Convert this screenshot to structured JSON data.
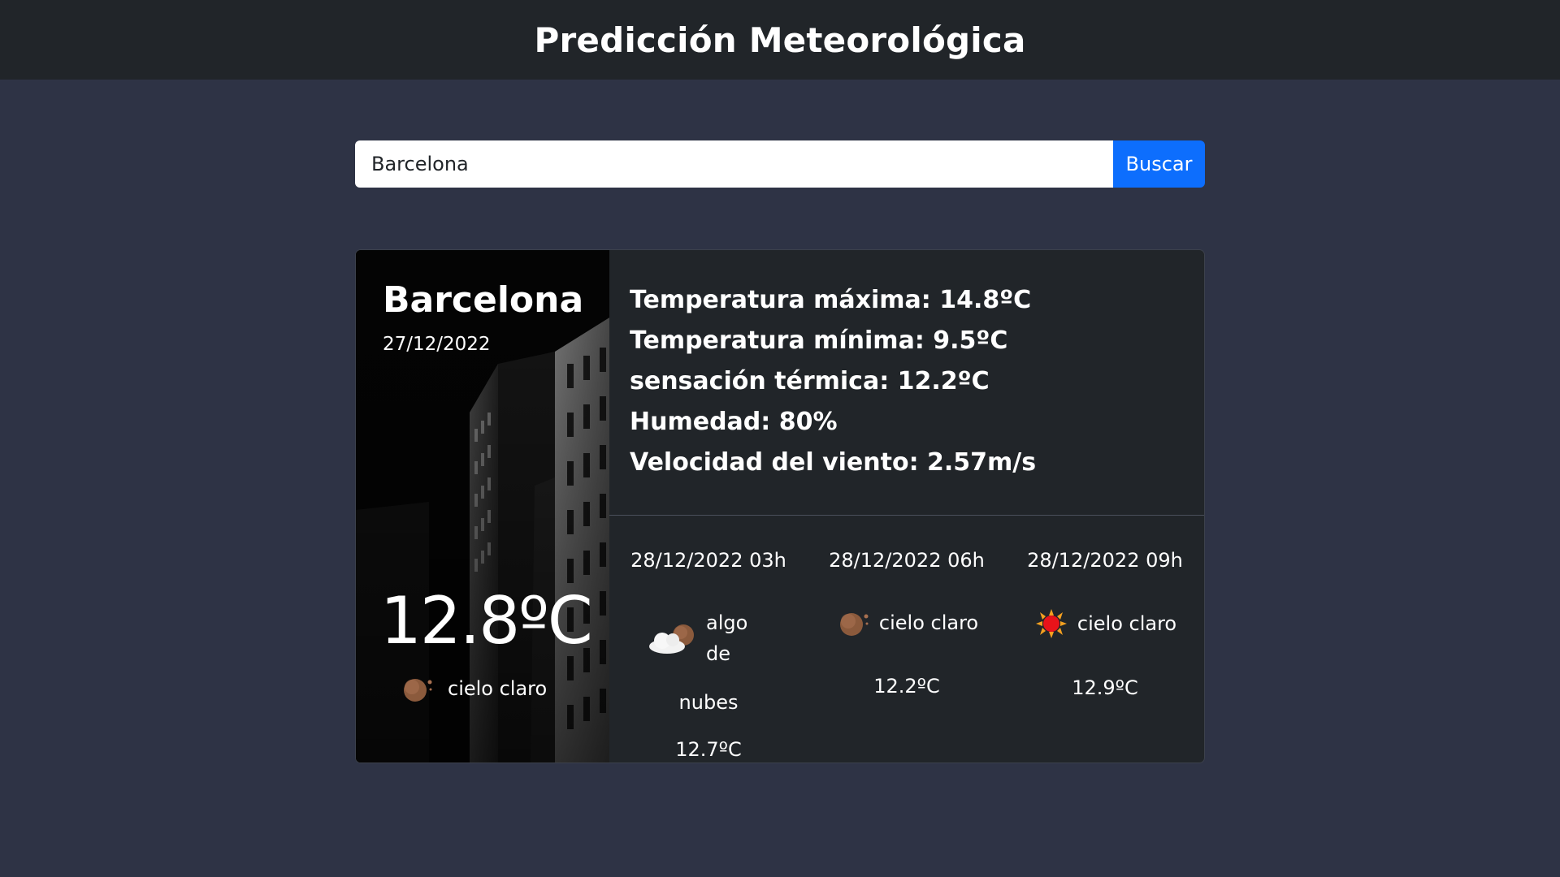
{
  "header": {
    "title": "Predicción Meteorológica"
  },
  "search": {
    "value": "Barcelona",
    "button_label": "Buscar"
  },
  "current": {
    "city": "Barcelona",
    "date": "27/12/2022",
    "temperature": "12.8ºC",
    "condition": "cielo claro",
    "condition_icon": "moon-icon"
  },
  "details": [
    "Temperatura máxima: 14.8ºC",
    "Temperatura mínima: 9.5ºC",
    "sensación térmica: 12.2ºC",
    "Humedad: 80%",
    "Velocidad del viento: 2.57m/s"
  ],
  "forecast": [
    {
      "time": "28/12/2022 03h",
      "condition": "algo de nubes",
      "condition_word1": "algo de",
      "condition_word2": "nubes",
      "icon": "cloud-moon-icon",
      "temp": "12.7ºC"
    },
    {
      "time": "28/12/2022 06h",
      "condition": "cielo claro",
      "icon": "moon-icon",
      "temp": "12.2ºC"
    },
    {
      "time": "28/12/2022 09h",
      "condition": "cielo claro",
      "icon": "sun-icon",
      "temp": "12.9ºC"
    }
  ],
  "colors": {
    "page_bg": "#2e3345",
    "header_bg": "#212529",
    "card_bg": "#212529",
    "accent": "#0d6efd"
  }
}
